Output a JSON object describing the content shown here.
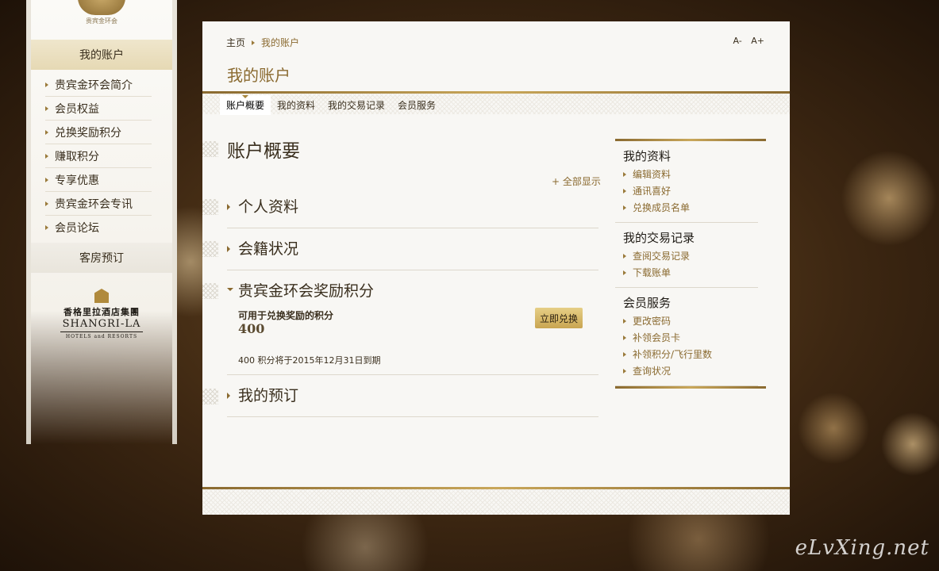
{
  "sidebar": {
    "top_logo_text": "贵宾金环会",
    "header": "我的账户",
    "items": [
      {
        "label": "贵宾金环会简介"
      },
      {
        "label": "会员权益"
      },
      {
        "label": "兑换奖励积分"
      },
      {
        "label": "赚取积分"
      },
      {
        "label": "专享优惠"
      },
      {
        "label": "贵宾金环会专讯"
      },
      {
        "label": "会员论坛"
      }
    ],
    "booking": "客房预订",
    "brand": {
      "cn": "香格里拉酒店集團",
      "en": "SHANGRI-LA",
      "sub": "HOTELS and RESORTS"
    }
  },
  "breadcrumb": {
    "home": "主页",
    "current": "我的账户"
  },
  "font_controls": {
    "decrease": "A-",
    "increase": "A+"
  },
  "page_title": "我的账户",
  "tabs": [
    {
      "label": "账户概要",
      "active": true
    },
    {
      "label": "我的资料"
    },
    {
      "label": "我的交易记录"
    },
    {
      "label": "会员服务"
    }
  ],
  "main": {
    "heading": "账户概要",
    "expand_all": "+ 全部显示",
    "sections": [
      {
        "title": "个人资料",
        "expanded": false
      },
      {
        "title": "会籍状况",
        "expanded": false
      },
      {
        "title": "贵宾金环会奖励积分",
        "expanded": true
      },
      {
        "title": "我的预订",
        "expanded": false
      }
    ],
    "points": {
      "label": "可用于兑换奖励的积分",
      "value": "400",
      "redeem_button": "立即兑换",
      "expiry_note": "400 积分将于2015年12月31日到期"
    }
  },
  "right_column": {
    "groups": [
      {
        "title": "我的资料",
        "links": [
          "编辑资料",
          "通讯喜好",
          "兑换成员名单"
        ]
      },
      {
        "title": "我的交易记录",
        "links": [
          "查阅交易记录",
          "下载账单"
        ]
      },
      {
        "title": "会员服务",
        "links": [
          "更改密码",
          "补领会员卡",
          "补领积分/飞行里数",
          "查询状况"
        ]
      }
    ]
  },
  "watermark": "eLvXing.net",
  "colors": {
    "gold": "#8a6a30",
    "gold_light": "#c9a75a",
    "button": "#d9bb6c"
  }
}
